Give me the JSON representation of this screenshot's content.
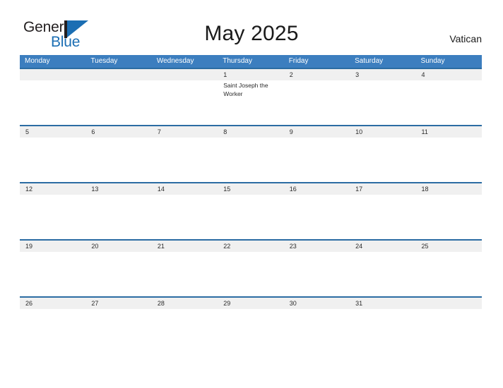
{
  "brand": {
    "name_part1": "General",
    "name_part2": "Blue",
    "flag_icon": "flag-icon",
    "accent_color": "#1b6eb3"
  },
  "header": {
    "title": "May 2025",
    "region": "Vatican"
  },
  "calendar": {
    "month": "May",
    "year": "2025",
    "header_bg": "#3c7ebf",
    "row_line_color": "#2b6ca3",
    "number_band_bg": "#f0f0f0",
    "day_names": [
      "Monday",
      "Tuesday",
      "Wednesday",
      "Thursday",
      "Friday",
      "Saturday",
      "Sunday"
    ],
    "weeks": [
      {
        "days": [
          {
            "number": "",
            "events": []
          },
          {
            "number": "",
            "events": []
          },
          {
            "number": "",
            "events": []
          },
          {
            "number": "1",
            "events": [
              "Saint Joseph the Worker"
            ]
          },
          {
            "number": "2",
            "events": []
          },
          {
            "number": "3",
            "events": []
          },
          {
            "number": "4",
            "events": []
          }
        ]
      },
      {
        "days": [
          {
            "number": "5",
            "events": []
          },
          {
            "number": "6",
            "events": []
          },
          {
            "number": "7",
            "events": []
          },
          {
            "number": "8",
            "events": []
          },
          {
            "number": "9",
            "events": []
          },
          {
            "number": "10",
            "events": []
          },
          {
            "number": "11",
            "events": []
          }
        ]
      },
      {
        "days": [
          {
            "number": "12",
            "events": []
          },
          {
            "number": "13",
            "events": []
          },
          {
            "number": "14",
            "events": []
          },
          {
            "number": "15",
            "events": []
          },
          {
            "number": "16",
            "events": []
          },
          {
            "number": "17",
            "events": []
          },
          {
            "number": "18",
            "events": []
          }
        ]
      },
      {
        "days": [
          {
            "number": "19",
            "events": []
          },
          {
            "number": "20",
            "events": []
          },
          {
            "number": "21",
            "events": []
          },
          {
            "number": "22",
            "events": []
          },
          {
            "number": "23",
            "events": []
          },
          {
            "number": "24",
            "events": []
          },
          {
            "number": "25",
            "events": []
          }
        ]
      },
      {
        "days": [
          {
            "number": "26",
            "events": []
          },
          {
            "number": "27",
            "events": []
          },
          {
            "number": "28",
            "events": []
          },
          {
            "number": "29",
            "events": []
          },
          {
            "number": "30",
            "events": []
          },
          {
            "number": "31",
            "events": []
          },
          {
            "number": "",
            "events": []
          }
        ]
      }
    ]
  }
}
